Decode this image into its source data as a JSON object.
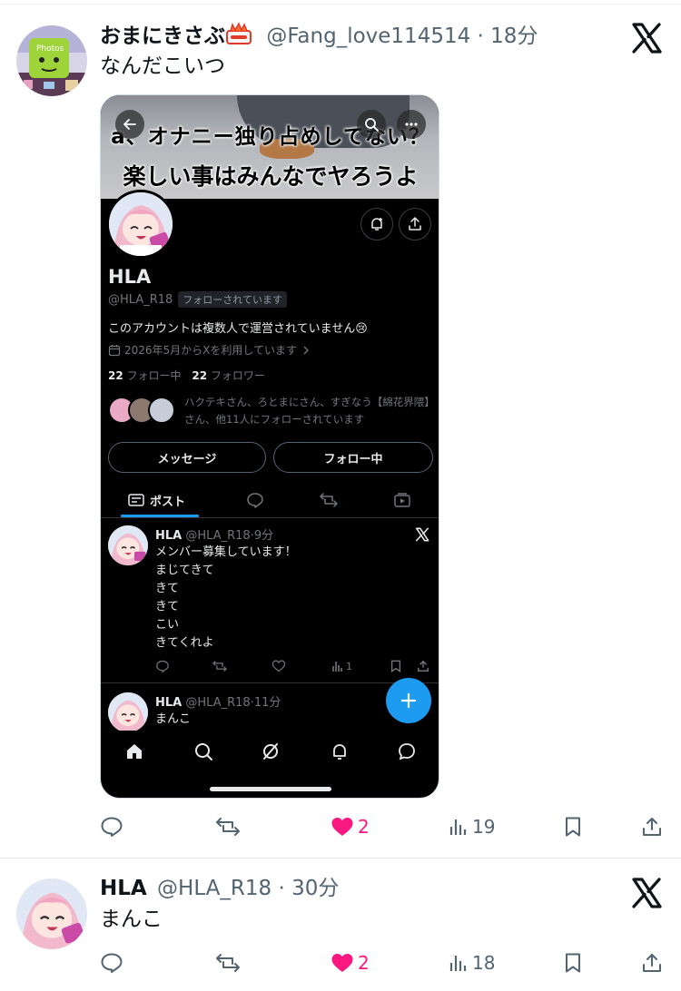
{
  "tweet1": {
    "name": "おまにきさぶ",
    "handle": "@Fang_love114514",
    "dot": "·",
    "time": "18分",
    "text": "なんだこいつ",
    "actions": {
      "reply": "",
      "retweet": "",
      "likes": "2",
      "views": "19"
    }
  },
  "screenshot": {
    "banner_line1": "a、オナニー独り占めしてない？",
    "banner_line2": "楽しい事はみんなでヤろうよ",
    "profile": {
      "name": "HLA",
      "handle": "@HLA_R18",
      "follows_you": "フォローされています",
      "bio": "このアカウントは複数人で運営されていません😢",
      "joined": "2026年5月からXを利用しています",
      "following_count": "22",
      "following_label": "フォロー中",
      "followers_count": "22",
      "followers_label": "フォロワー",
      "followed_by": "ハクテキさん、ろとまにさん、すぎなう【綿花界隈】さん、他11人にフォローされています",
      "message_button": "メッセージ",
      "following_button": "フォロー中"
    },
    "tabs": {
      "posts": "ポスト"
    },
    "posts": [
      {
        "name": "HLA",
        "handle": "@HLA_R18",
        "time": "9分",
        "lines": [
          "メンバー募集しています！",
          "まじてきて",
          "きて",
          "きて",
          "こい",
          "きてくれよ"
        ],
        "views": "1"
      },
      {
        "name": "HLA",
        "handle": "@HLA_R18",
        "time": "11分",
        "lines": [
          "まんこ"
        ]
      }
    ]
  },
  "tweet2": {
    "name": "HLA",
    "handle": "@HLA_R18",
    "dot": "·",
    "time": "30分",
    "text": "まんこ",
    "actions": {
      "likes": "2",
      "views": "18"
    }
  },
  "colors": {
    "like": "#f91880",
    "accent": "#1d9bf0",
    "muted": "#536471"
  }
}
